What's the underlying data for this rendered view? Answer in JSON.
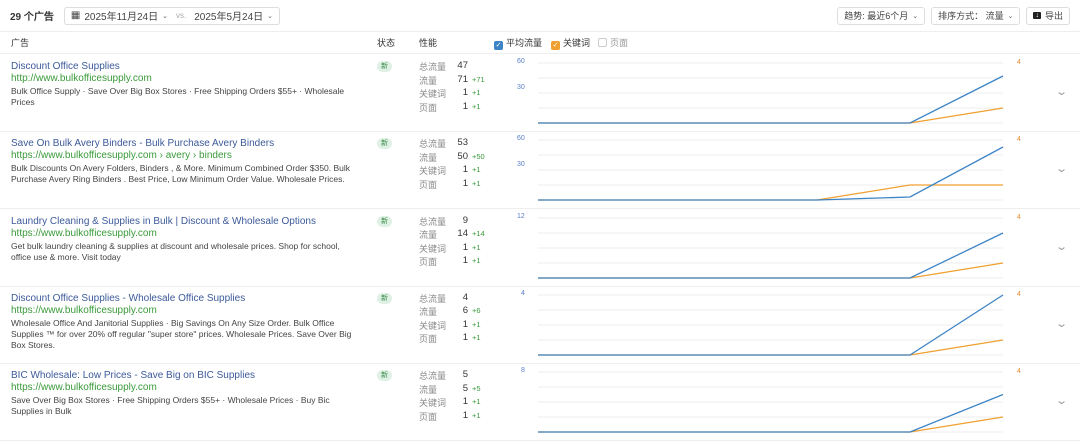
{
  "toolbar": {
    "count": "29 个广告",
    "date_current": "2025年11月24日",
    "vs": "vs.",
    "date_compare": "2025年5月24日",
    "trend": "趋势: 最近6个月",
    "sort": "排序方式： 流量",
    "export": "导出"
  },
  "header": {
    "ad": "广告",
    "status": "状态",
    "performance": "性能",
    "legend": [
      {
        "label": "平均流量",
        "checked": true,
        "color": "#3d84c6"
      },
      {
        "label": "关键词",
        "checked": true,
        "color": "#f0a030"
      },
      {
        "label": "页面",
        "checked": false,
        "color": "#cccccc"
      }
    ]
  },
  "metric_labels": [
    "总流量",
    "流量",
    "关键词",
    "页面"
  ],
  "rows": [
    {
      "title": "Discount Office Supplies",
      "url": "http://www.bulkofficesupply.com",
      "desc": "Bulk Office Supply · Save Over Big Box Stores · Free Shipping Orders $55+ · Wholesale Prices",
      "status": "新",
      "metrics": [
        {
          "v": "47",
          "d": ""
        },
        {
          "v": "71",
          "d": "+71"
        },
        {
          "v": "1",
          "d": "+1"
        },
        {
          "v": "1",
          "d": "+1"
        }
      ],
      "axis_left": [
        "60",
        "30"
      ],
      "axis_right": "4",
      "ymax": 60,
      "traffic": [
        0,
        0,
        0,
        0,
        0,
        47
      ],
      "keywords": [
        0,
        0,
        0,
        0,
        0,
        1
      ]
    },
    {
      "title": "Save On Bulk Avery Binders - Bulk Purchase Avery Binders",
      "url": "https://www.bulkofficesupply.com › avery › binders",
      "desc": "Bulk Discounts On Avery Folders, Binders , & More. Minimum Combined Order $350. Bulk Purchase Avery Ring Binders . Best Price, Low Minimum Order Value. Wholesale Prices.",
      "status": "新",
      "metrics": [
        {
          "v": "53",
          "d": ""
        },
        {
          "v": "50",
          "d": "+50"
        },
        {
          "v": "1",
          "d": "+1"
        },
        {
          "v": "1",
          "d": "+1"
        }
      ],
      "axis_left": [
        "60",
        "30"
      ],
      "axis_right": "4",
      "ymax": 60,
      "traffic": [
        0,
        0,
        0,
        0,
        3,
        53
      ],
      "keywords": [
        0,
        0,
        0,
        0,
        1,
        1
      ]
    },
    {
      "title": "Laundry Cleaning & Supplies in Bulk | Discount & Wholesale Options",
      "url": "https://www.bulkofficesupply.com",
      "desc": "Get bulk laundry cleaning & supplies at discount and wholesale prices. Shop for school, office use & more. Visit today",
      "status": "新",
      "metrics": [
        {
          "v": "9",
          "d": ""
        },
        {
          "v": "14",
          "d": "+14"
        },
        {
          "v": "1",
          "d": "+1"
        },
        {
          "v": "1",
          "d": "+1"
        }
      ],
      "axis_left": [
        "12"
      ],
      "axis_right": "4",
      "ymax": 12,
      "traffic": [
        0,
        0,
        0,
        0,
        0,
        9
      ],
      "keywords": [
        0,
        0,
        0,
        0,
        0,
        1
      ]
    },
    {
      "title": "Discount Office Supplies - Wholesale Office Supplies",
      "url": "https://www.bulkofficesupply.com",
      "desc": "Wholesale Office And Janitorial Supplies · Big Savings On Any Size Order. Bulk Office Supplies ™ for over 20% off regular \"super store\" prices. Wholesale Prices. Save Over Big Box Stores.",
      "status": "新",
      "metrics": [
        {
          "v": "4",
          "d": ""
        },
        {
          "v": "6",
          "d": "+6"
        },
        {
          "v": "1",
          "d": "+1"
        },
        {
          "v": "1",
          "d": "+1"
        }
      ],
      "axis_left": [
        "4"
      ],
      "axis_right": "4",
      "ymax": 4,
      "traffic": [
        0,
        0,
        0,
        0,
        0,
        4
      ],
      "keywords": [
        0,
        0,
        0,
        0,
        0,
        1
      ]
    },
    {
      "title": "BIC Wholesale: Low Prices - Save Big on BIC Supplies",
      "url": "https://www.bulkofficesupply.com",
      "desc": "Save Over Big Box Stores · Free Shipping Orders $55+ · Wholesale Prices · Buy Bic Supplies in Bulk",
      "status": "新",
      "metrics": [
        {
          "v": "5",
          "d": ""
        },
        {
          "v": "5",
          "d": "+5"
        },
        {
          "v": "1",
          "d": "+1"
        },
        {
          "v": "1",
          "d": "+1"
        }
      ],
      "axis_left": [
        "8"
      ],
      "axis_right": "4",
      "ymax": 8,
      "traffic": [
        0,
        0,
        0,
        0,
        0,
        5
      ],
      "keywords": [
        0,
        0,
        0,
        0,
        0,
        1
      ]
    }
  ]
}
